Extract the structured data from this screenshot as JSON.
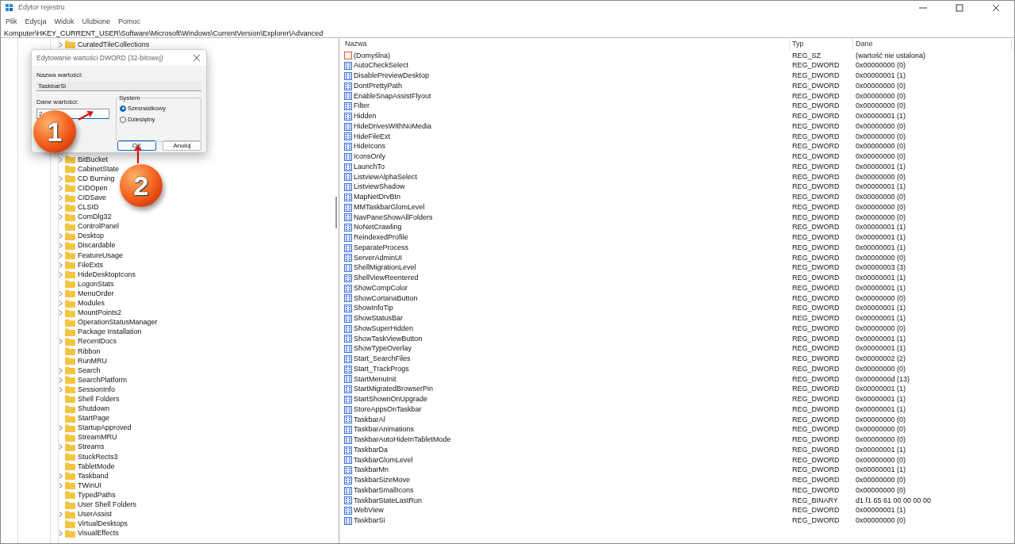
{
  "window": {
    "title": "Edytor rejestru"
  },
  "menu": [
    "Plik",
    "Edycja",
    "Widok",
    "Ulubione",
    "Pomoc"
  ],
  "address": "Komputer\\HKEY_CURRENT_USER\\Software\\Microsoft\\Windows\\CurrentVersion\\Explorer\\Advanced",
  "tree": {
    "items": [
      {
        "label": "CuratedTileCollections",
        "expandable": true
      },
      {
        "label": "BitBucket",
        "expandable": true
      },
      {
        "label": "CabinetState",
        "expandable": false
      },
      {
        "label": "CD Burning",
        "expandable": true
      },
      {
        "label": "CIDOpen",
        "expandable": true
      },
      {
        "label": "CIDSave",
        "expandable": true
      },
      {
        "label": "CLSID",
        "expandable": true
      },
      {
        "label": "ComDlg32",
        "expandable": true
      },
      {
        "label": "ControlPanel",
        "expandable": false
      },
      {
        "label": "Desktop",
        "expandable": true
      },
      {
        "label": "Discardable",
        "expandable": true
      },
      {
        "label": "FeatureUsage",
        "expandable": true
      },
      {
        "label": "FileExts",
        "expandable": true
      },
      {
        "label": "HideDesktopIcons",
        "expandable": true
      },
      {
        "label": "LogonStats",
        "expandable": false
      },
      {
        "label": "MenuOrder",
        "expandable": true
      },
      {
        "label": "Modules",
        "expandable": true
      },
      {
        "label": "MountPoints2",
        "expandable": true
      },
      {
        "label": "OperationStatusManager",
        "expandable": false
      },
      {
        "label": "Package Installation",
        "expandable": false
      },
      {
        "label": "RecentDocs",
        "expandable": true
      },
      {
        "label": "Ribbon",
        "expandable": false
      },
      {
        "label": "RunMRU",
        "expandable": false
      },
      {
        "label": "Search",
        "expandable": true
      },
      {
        "label": "SearchPlatform",
        "expandable": true
      },
      {
        "label": "SessionInfo",
        "expandable": true
      },
      {
        "label": "Shell Folders",
        "expandable": false
      },
      {
        "label": "Shutdown",
        "expandable": false
      },
      {
        "label": "StartPage",
        "expandable": false
      },
      {
        "label": "StartupApproved",
        "expandable": true
      },
      {
        "label": "StreamMRU",
        "expandable": false
      },
      {
        "label": "Streams",
        "expandable": true
      },
      {
        "label": "StuckRects3",
        "expandable": false
      },
      {
        "label": "TabletMode",
        "expandable": false
      },
      {
        "label": "Taskband",
        "expandable": true
      },
      {
        "label": "TWinUI",
        "expandable": true
      },
      {
        "label": "TypedPaths",
        "expandable": false
      },
      {
        "label": "User Shell Folders",
        "expandable": false
      },
      {
        "label": "UserAssist",
        "expandable": true
      },
      {
        "label": "VirtualDesktops",
        "expandable": false
      },
      {
        "label": "VisualEffects",
        "expandable": true
      }
    ]
  },
  "table": {
    "columns": [
      "Nazwa",
      "Typ",
      "Dane"
    ],
    "rows": [
      {
        "kind": "text",
        "name": "(Domyślna)",
        "type": "REG_SZ",
        "data": "(wartość nie ustalona)"
      },
      {
        "kind": "binary",
        "name": "AutoCheckSelect",
        "type": "REG_DWORD",
        "data": "0x00000000 (0)"
      },
      {
        "kind": "binary",
        "name": "DisablePreviewDesktop",
        "type": "REG_DWORD",
        "data": "0x00000001 (1)"
      },
      {
        "kind": "binary",
        "name": "DontPrettyPath",
        "type": "REG_DWORD",
        "data": "0x00000000 (0)"
      },
      {
        "kind": "binary",
        "name": "EnableSnapAssistFlyout",
        "type": "REG_DWORD",
        "data": "0x00000000 (0)"
      },
      {
        "kind": "binary",
        "name": "Filter",
        "type": "REG_DWORD",
        "data": "0x00000000 (0)"
      },
      {
        "kind": "binary",
        "name": "Hidden",
        "type": "REG_DWORD",
        "data": "0x00000001 (1)"
      },
      {
        "kind": "binary",
        "name": "HideDrivesWithNoMedia",
        "type": "REG_DWORD",
        "data": "0x00000000 (0)"
      },
      {
        "kind": "binary",
        "name": "HideFileExt",
        "type": "REG_DWORD",
        "data": "0x00000000 (0)"
      },
      {
        "kind": "binary",
        "name": "HideIcons",
        "type": "REG_DWORD",
        "data": "0x00000000 (0)"
      },
      {
        "kind": "binary",
        "name": "IconsOnly",
        "type": "REG_DWORD",
        "data": "0x00000000 (0)"
      },
      {
        "kind": "binary",
        "name": "LaunchTo",
        "type": "REG_DWORD",
        "data": "0x00000001 (1)"
      },
      {
        "kind": "binary",
        "name": "ListviewAlphaSelect",
        "type": "REG_DWORD",
        "data": "0x00000000 (0)"
      },
      {
        "kind": "binary",
        "name": "ListviewShadow",
        "type": "REG_DWORD",
        "data": "0x00000001 (1)"
      },
      {
        "kind": "binary",
        "name": "MapNetDrvBtn",
        "type": "REG_DWORD",
        "data": "0x00000000 (0)"
      },
      {
        "kind": "binary",
        "name": "MMTaskbarGlomLevel",
        "type": "REG_DWORD",
        "data": "0x00000000 (0)"
      },
      {
        "kind": "binary",
        "name": "NavPaneShowAllFolders",
        "type": "REG_DWORD",
        "data": "0x00000000 (0)"
      },
      {
        "kind": "binary",
        "name": "NoNetCrawling",
        "type": "REG_DWORD",
        "data": "0x00000001 (1)"
      },
      {
        "kind": "binary",
        "name": "ReindexedProfile",
        "type": "REG_DWORD",
        "data": "0x00000001 (1)"
      },
      {
        "kind": "binary",
        "name": "SeparateProcess",
        "type": "REG_DWORD",
        "data": "0x00000001 (1)"
      },
      {
        "kind": "binary",
        "name": "ServerAdminUI",
        "type": "REG_DWORD",
        "data": "0x00000000 (0)"
      },
      {
        "kind": "binary",
        "name": "ShellMigrationLevel",
        "type": "REG_DWORD",
        "data": "0x00000003 (3)"
      },
      {
        "kind": "binary",
        "name": "ShellViewReentered",
        "type": "REG_DWORD",
        "data": "0x00000001 (1)"
      },
      {
        "kind": "binary",
        "name": "ShowCompColor",
        "type": "REG_DWORD",
        "data": "0x00000001 (1)"
      },
      {
        "kind": "binary",
        "name": "ShowCortanaButton",
        "type": "REG_DWORD",
        "data": "0x00000000 (0)"
      },
      {
        "kind": "binary",
        "name": "ShowInfoTip",
        "type": "REG_DWORD",
        "data": "0x00000001 (1)"
      },
      {
        "kind": "binary",
        "name": "ShowStatusBar",
        "type": "REG_DWORD",
        "data": "0x00000001 (1)"
      },
      {
        "kind": "binary",
        "name": "ShowSuperHidden",
        "type": "REG_DWORD",
        "data": "0x00000000 (0)"
      },
      {
        "kind": "binary",
        "name": "ShowTaskViewButton",
        "type": "REG_DWORD",
        "data": "0x00000001 (1)"
      },
      {
        "kind": "binary",
        "name": "ShowTypeOverlay",
        "type": "REG_DWORD",
        "data": "0x00000001 (1)"
      },
      {
        "kind": "binary",
        "name": "Start_SearchFiles",
        "type": "REG_DWORD",
        "data": "0x00000002 (2)"
      },
      {
        "kind": "binary",
        "name": "Start_TrackProgs",
        "type": "REG_DWORD",
        "data": "0x00000000 (0)"
      },
      {
        "kind": "binary",
        "name": "StartMenuInit",
        "type": "REG_DWORD",
        "data": "0x0000000d (13)"
      },
      {
        "kind": "binary",
        "name": "StartMigratedBrowserPin",
        "type": "REG_DWORD",
        "data": "0x00000001 (1)"
      },
      {
        "kind": "binary",
        "name": "StartShownOnUpgrade",
        "type": "REG_DWORD",
        "data": "0x00000001 (1)"
      },
      {
        "kind": "binary",
        "name": "StoreAppsOnTaskbar",
        "type": "REG_DWORD",
        "data": "0x00000001 (1)"
      },
      {
        "kind": "binary",
        "name": "TaskbarAl",
        "type": "REG_DWORD",
        "data": "0x00000000 (0)"
      },
      {
        "kind": "binary",
        "name": "TaskbarAnimations",
        "type": "REG_DWORD",
        "data": "0x00000000 (0)"
      },
      {
        "kind": "binary",
        "name": "TaskbarAutoHideInTabletMode",
        "type": "REG_DWORD",
        "data": "0x00000000 (0)"
      },
      {
        "kind": "binary",
        "name": "TaskbarDa",
        "type": "REG_DWORD",
        "data": "0x00000001 (1)"
      },
      {
        "kind": "binary",
        "name": "TaskbarGlomLevel",
        "type": "REG_DWORD",
        "data": "0x00000000 (0)"
      },
      {
        "kind": "binary",
        "name": "TaskbarMn",
        "type": "REG_DWORD",
        "data": "0x00000001 (1)"
      },
      {
        "kind": "binary",
        "name": "TaskbarSizeMove",
        "type": "REG_DWORD",
        "data": "0x00000000 (0)"
      },
      {
        "kind": "binary",
        "name": "TaskbarSmallIcons",
        "type": "REG_DWORD",
        "data": "0x00000000 (0)"
      },
      {
        "kind": "binary",
        "name": "TaskbarStateLastRun",
        "type": "REG_BINARY",
        "data": "d1 f1 65 61 00 00 00 00"
      },
      {
        "kind": "binary",
        "name": "WebView",
        "type": "REG_DWORD",
        "data": "0x00000001 (1)"
      },
      {
        "kind": "binary",
        "name": "TaskbarSi",
        "type": "REG_DWORD",
        "data": "0x00000000 (0)"
      }
    ]
  },
  "dialog": {
    "title": "Edytowanie wartości DWORD (32-bitowej)",
    "name_label": "Nazwa wartości:",
    "name_value": "TaskbarSi",
    "data_label": "Dane wartości:",
    "data_value": "2",
    "group_label": "System",
    "radios": [
      {
        "label": "Szesnastkowy",
        "selected": true
      },
      {
        "label": "Dziesiętny",
        "selected": false
      }
    ],
    "buttons": [
      {
        "label": "OK",
        "default": true
      },
      {
        "label": "Anuluj",
        "default": false
      }
    ]
  },
  "annotations": [
    "1",
    "2"
  ]
}
